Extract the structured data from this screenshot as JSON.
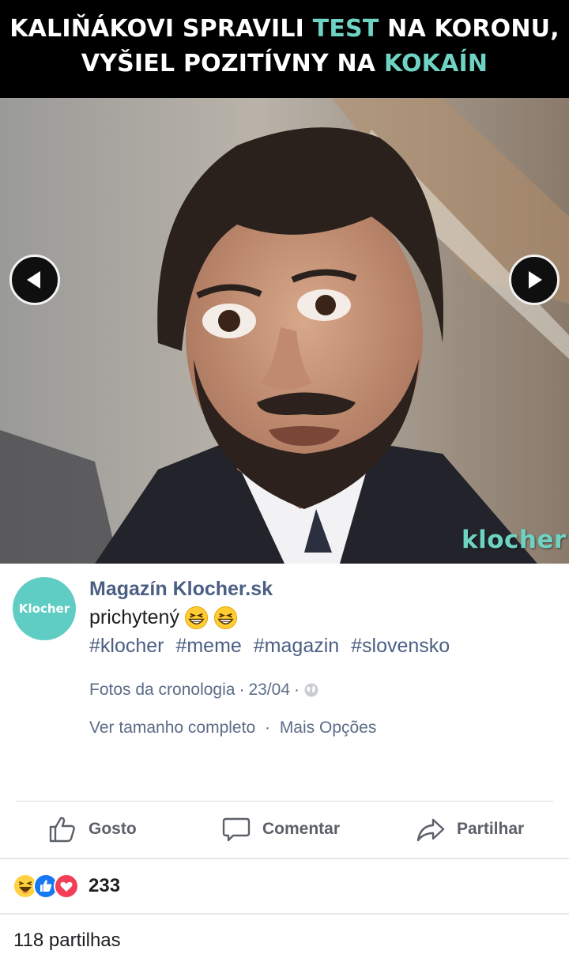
{
  "colors": {
    "headline_accent": "#6fd3c3",
    "link": "#4b5f83",
    "muted": "#5c6b86",
    "avatar_bg": "#5fcdc4"
  },
  "photo": {
    "headline": {
      "line1_a": "KALIŇÁKOVI SPRAVILI",
      "line1_highlight": "TEST",
      "line1_b": "NA KORONU,",
      "line2_a": "VYŠIEL POZITÍVNY NA",
      "line2_highlight": "KOKAÍN"
    },
    "watermark": "klocher",
    "prev_icon": "chevron-left-icon",
    "next_icon": "chevron-right-icon"
  },
  "post": {
    "avatar_text": "Klocher",
    "page_name": "Magazín Klocher.sk",
    "caption": "prichytený",
    "caption_emojis": [
      "grinning-squinting-face",
      "grinning-squinting-face"
    ],
    "hashtags": [
      "#klocher",
      "#meme",
      "#magazin",
      "#slovensko"
    ],
    "meta": {
      "album": "Fotos da cronologia",
      "date": "23/04",
      "separator": "·",
      "audience_icon": "globe-icon"
    },
    "options": {
      "full_size": "Ver tamanho completo",
      "separator": "·",
      "more": "Mais Opções"
    }
  },
  "actions": {
    "like": "Gosto",
    "comment": "Comentar",
    "share": "Partilhar"
  },
  "reactions": {
    "types": [
      "haha",
      "like",
      "love"
    ],
    "count": "233"
  },
  "shares": "118 partilhas"
}
